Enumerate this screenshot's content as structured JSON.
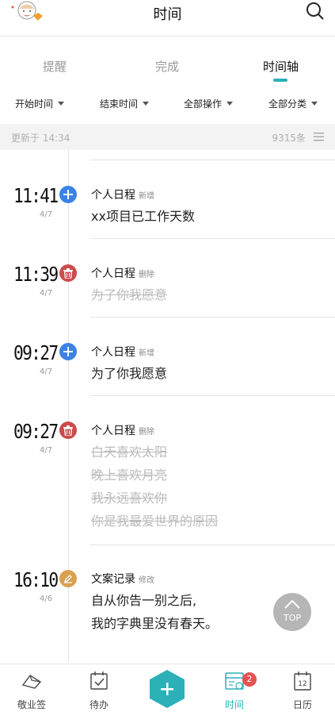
{
  "header": {
    "title": "时间"
  },
  "tabs": [
    {
      "label": "提醒",
      "active": false
    },
    {
      "label": "完成",
      "active": false
    },
    {
      "label": "时间轴",
      "active": true
    }
  ],
  "filters": [
    "开始时间",
    "结束时间",
    "全部操作",
    "全部分类"
  ],
  "update_bar": {
    "updated": "更新于 14:34",
    "count": "9315条"
  },
  "entries": [
    {
      "time": "11:41",
      "date": "4/7",
      "category": "个人日程",
      "action": "新增",
      "icon": "plus-icon",
      "color": "#3b82e6",
      "lines": [
        {
          "text": "xx项目已工作天数",
          "struck": false
        }
      ]
    },
    {
      "time": "11:39",
      "date": "4/7",
      "category": "个人日程",
      "action": "删除",
      "icon": "trash-icon",
      "color": "#cc4b4b",
      "lines": [
        {
          "text": "为了你我愿意",
          "struck": true
        }
      ]
    },
    {
      "time": "09:27",
      "date": "4/7",
      "category": "个人日程",
      "action": "新增",
      "icon": "plus-icon",
      "color": "#3b82e6",
      "lines": [
        {
          "text": "为了你我愿意",
          "struck": false
        }
      ]
    },
    {
      "time": "09:27",
      "date": "4/7",
      "category": "个人日程",
      "action": "删除",
      "icon": "trash-icon",
      "color": "#cc4b4b",
      "lines": [
        {
          "text": "白天喜欢太阳",
          "struck": true
        },
        {
          "text": "晚上喜欢月亮",
          "struck": true
        },
        {
          "text": "我永远喜欢你",
          "struck": true
        },
        {
          "text": "你是我最爱世界的原因",
          "struck": true
        }
      ]
    },
    {
      "time": "16:10",
      "date": "4/6",
      "category": "文案记录",
      "action": "修改",
      "icon": "edit-icon",
      "color": "#d9a052",
      "lines": [
        {
          "text": "自从你告一别之后,",
          "struck": false
        },
        {
          "text": "我的字典里没有春天。",
          "struck": false
        }
      ]
    }
  ],
  "top_button": {
    "label": "TOP"
  },
  "bottom_nav": [
    {
      "label": "敬业签",
      "icon": "logo-icon",
      "active": false
    },
    {
      "label": "待办",
      "icon": "todo-icon",
      "active": false
    },
    {
      "label": "",
      "icon": "add-icon",
      "active": false
    },
    {
      "label": "时间",
      "icon": "time-icon",
      "active": true,
      "badge": "2"
    },
    {
      "label": "日历",
      "icon": "calendar-icon",
      "active": false,
      "day": "12"
    }
  ],
  "colors": {
    "accent": "#2bb0b8",
    "add": "#3b82e6",
    "delete": "#cc4b4b",
    "edit": "#d9a052",
    "badge": "#e45151"
  }
}
